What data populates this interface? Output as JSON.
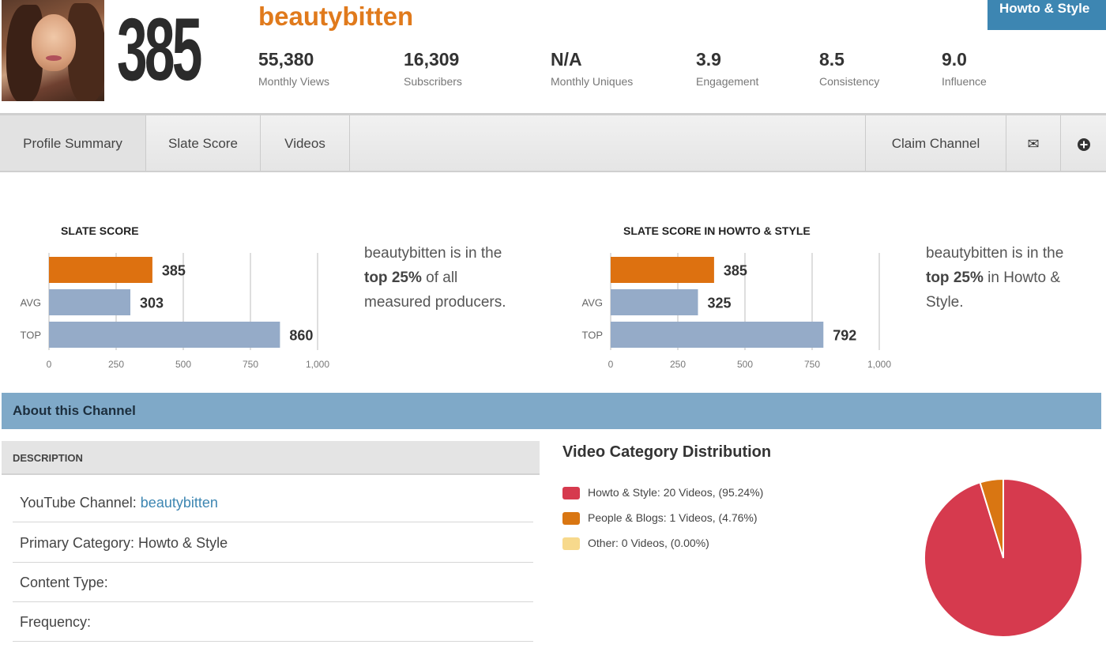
{
  "header": {
    "score": "385",
    "channel_name": "beautybitten",
    "category_badge": "Howto & Style",
    "stats": [
      {
        "value": "55,380",
        "label": "Monthly Views"
      },
      {
        "value": "16,309",
        "label": "Subscribers"
      },
      {
        "value": "N/A",
        "label": "Monthly Uniques"
      },
      {
        "value": "3.9",
        "label": "Engagement"
      },
      {
        "value": "8.5",
        "label": "Consistency"
      },
      {
        "value": "9.0",
        "label": "Influence"
      }
    ]
  },
  "nav": {
    "tabs": [
      "Profile Summary",
      "Slate Score",
      "Videos"
    ],
    "active_tab": "Profile Summary",
    "claim_label": "Claim Channel",
    "icons": [
      "envelope-icon",
      "plus-circle-icon"
    ]
  },
  "chart_data": [
    {
      "type": "bar",
      "title": "SLATE SCORE",
      "categories": [
        "",
        "AVG",
        "TOP"
      ],
      "values": [
        385,
        303,
        860
      ],
      "data_labels": [
        "385",
        "303",
        "860"
      ],
      "colors": [
        "#dd7110",
        "#95abc8",
        "#95abc8"
      ],
      "xlim": [
        0,
        1000
      ],
      "xticks": [
        "0",
        "250",
        "500",
        "750",
        "1,000"
      ],
      "grid": true,
      "orientation": "horizontal"
    },
    {
      "type": "bar",
      "title": "SLATE SCORE IN HOWTO & STYLE",
      "categories": [
        "",
        "AVG",
        "TOP"
      ],
      "values": [
        385,
        325,
        792
      ],
      "data_labels": [
        "385",
        "325",
        "792"
      ],
      "colors": [
        "#dd7110",
        "#95abc8",
        "#95abc8"
      ],
      "xlim": [
        0,
        1000
      ],
      "xticks": [
        "0",
        "250",
        "500",
        "750",
        "1,000"
      ],
      "grid": true,
      "orientation": "horizontal"
    },
    {
      "type": "pie",
      "title": "Video Category Distribution",
      "slices": [
        {
          "label": "Howto & Style: 20 Videos, (95.24%)",
          "value": 95.24,
          "color": "#d63a4e"
        },
        {
          "label": "People & Blogs: 1 Videos, (4.76%)",
          "value": 4.76,
          "color": "#d97612"
        },
        {
          "label": "Other: 0 Videos, (0.00%)",
          "value": 0,
          "color": "#f7d98c"
        }
      ]
    }
  ],
  "summaries": {
    "overall": {
      "line1": "beautybitten is in the",
      "bold": "top 25%",
      "line2_rest": " of all",
      "line3": "measured producers."
    },
    "category": {
      "line1": "beautybitten is in the",
      "bold": "top 25%",
      "line2_rest": " in Howto &",
      "line3": "Style."
    }
  },
  "about": {
    "bar_title": "About this Channel",
    "description_header": "DESCRIPTION",
    "rows": [
      {
        "label": "YouTube Channel: ",
        "value": "beautybitten"
      },
      {
        "label": "Primary Category: Howto & Style",
        "value": ""
      },
      {
        "label": "Content Type:",
        "value": ""
      },
      {
        "label": "Frequency:",
        "value": ""
      }
    ]
  },
  "colors": {
    "accent_orange": "#e07a1c",
    "badge_blue": "#3d86b2",
    "about_bar": "#7fa9c8"
  }
}
